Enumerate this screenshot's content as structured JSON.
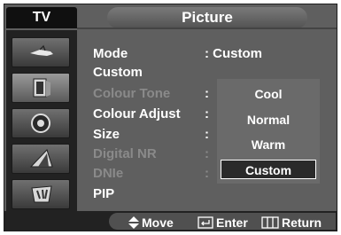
{
  "header": {
    "tab_label": "TV",
    "title": "Picture"
  },
  "sidebar": {
    "items": [
      {
        "icon": "antenna-icon"
      },
      {
        "icon": "picture-icon"
      },
      {
        "icon": "sound-icon"
      },
      {
        "icon": "channel-icon"
      },
      {
        "icon": "setup-icon"
      }
    ]
  },
  "menu": {
    "mode_label": "Mode",
    "mode_value": ": Custom",
    "custom_label": "Custom",
    "colour_tone_label": "Colour Tone",
    "colour_adjust_label": "Colour Adjust",
    "size_label": "Size",
    "digital_nr_label": "Digital NR",
    "dnie_label": "DNIe",
    "pip_label": "PIP",
    "colon": ":"
  },
  "dropdown": {
    "options": [
      "Cool",
      "Normal",
      "Warm",
      "Custom"
    ],
    "selected": "Custom"
  },
  "footer": {
    "move": "Move",
    "enter": "Enter",
    "return": "Return"
  }
}
